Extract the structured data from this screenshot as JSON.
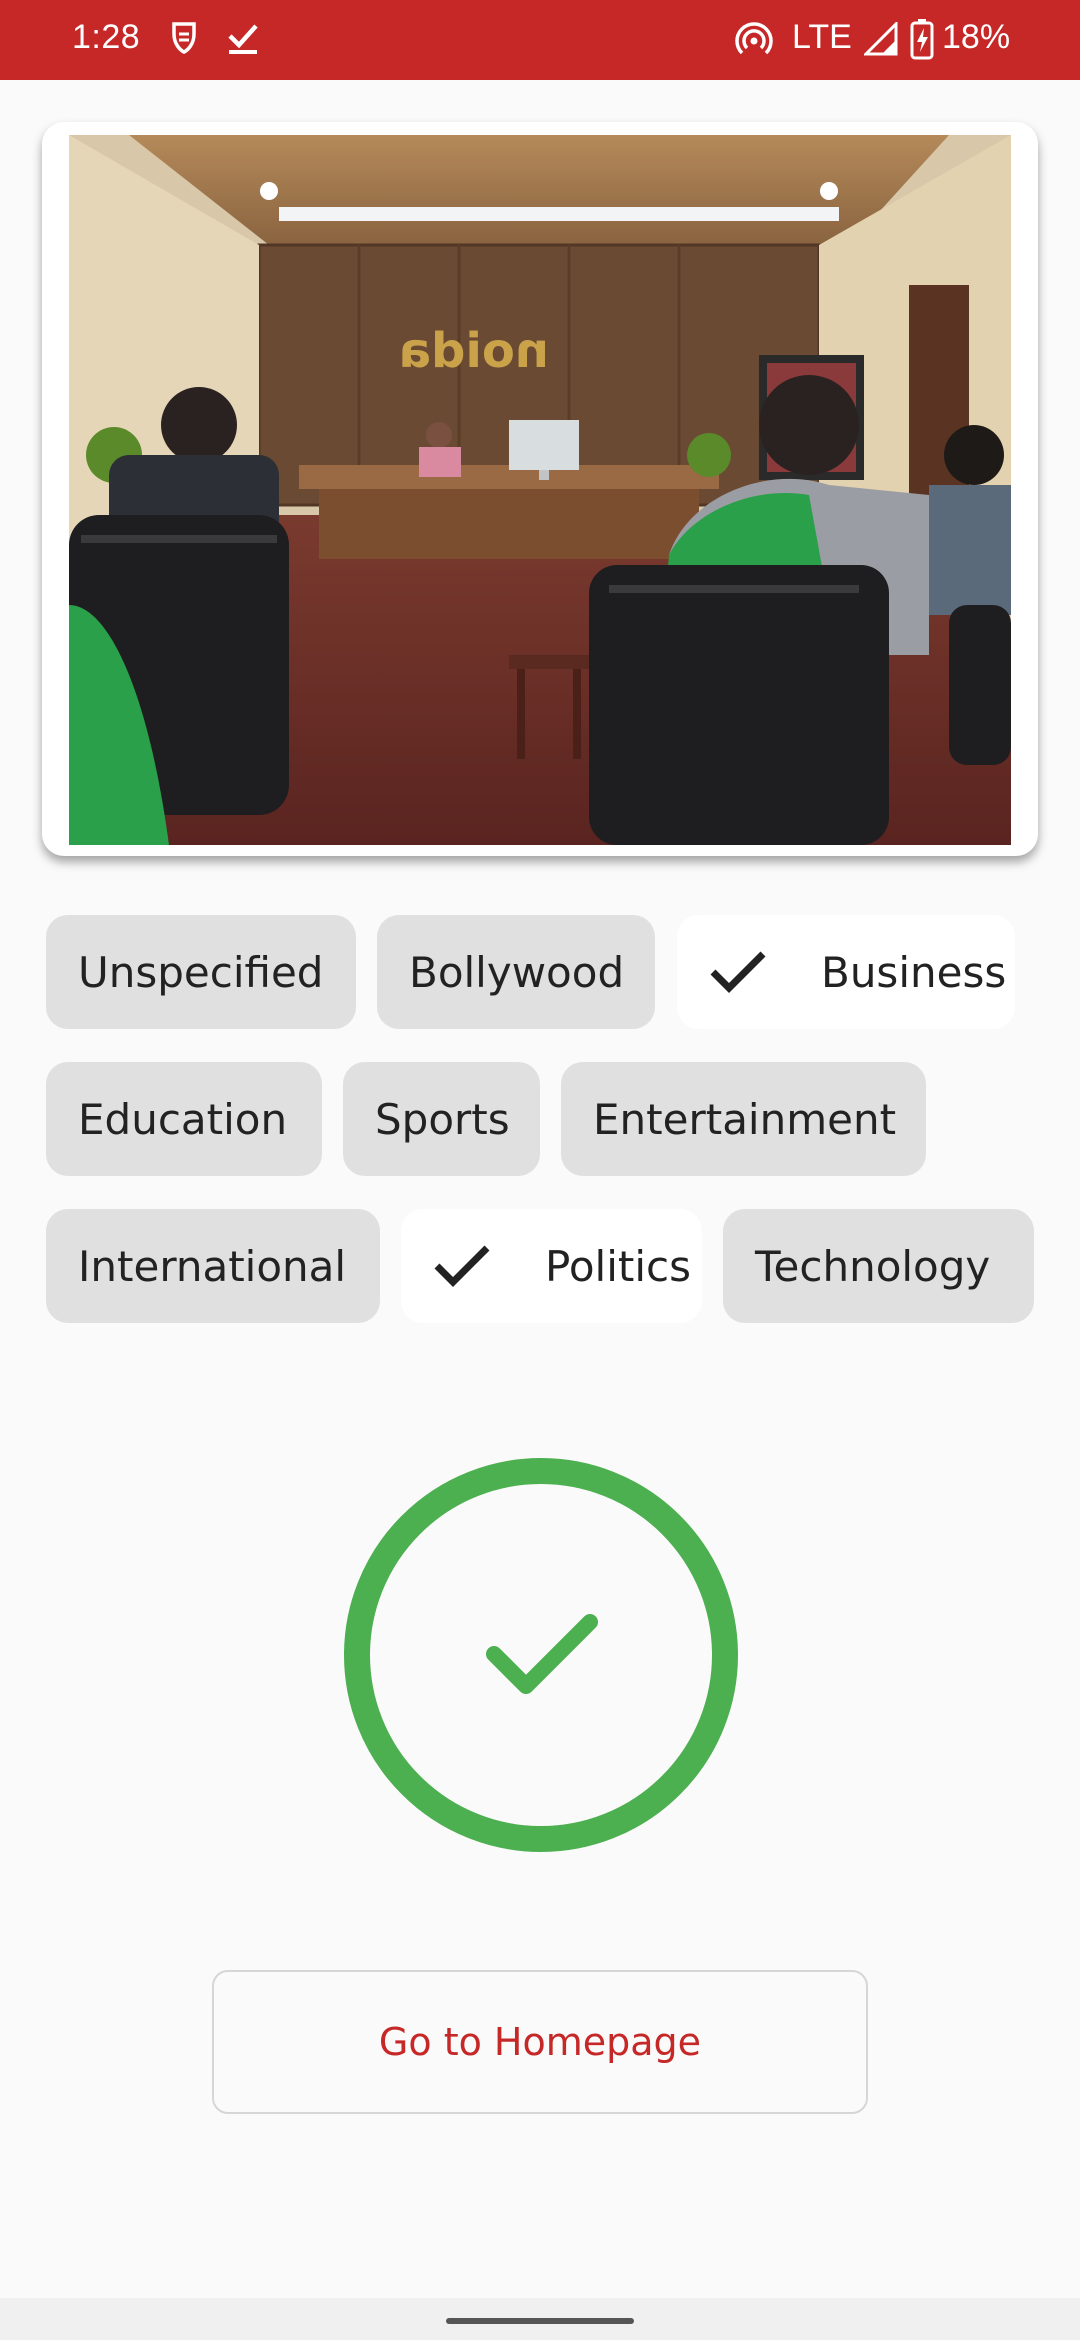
{
  "status_bar": {
    "time": "1:28",
    "network": "LTE",
    "battery": "18%",
    "color": "#c62828"
  },
  "article_image": {
    "sign_text": "noida"
  },
  "chips": [
    {
      "label": "Unspecified",
      "selected": false
    },
    {
      "label": "Bollywood",
      "selected": false
    },
    {
      "label": "Business",
      "selected": true
    },
    {
      "label": "Education",
      "selected": false
    },
    {
      "label": "Sports",
      "selected": false
    },
    {
      "label": "Entertainment",
      "selected": false
    },
    {
      "label": "International",
      "selected": false
    },
    {
      "label": "Politics",
      "selected": true
    },
    {
      "label": "Technology",
      "selected": false
    }
  ],
  "success": {
    "icon": "check-circle-icon",
    "color": "#4caf50"
  },
  "home_button": {
    "label": "Go to Homepage",
    "color": "#c62828"
  }
}
